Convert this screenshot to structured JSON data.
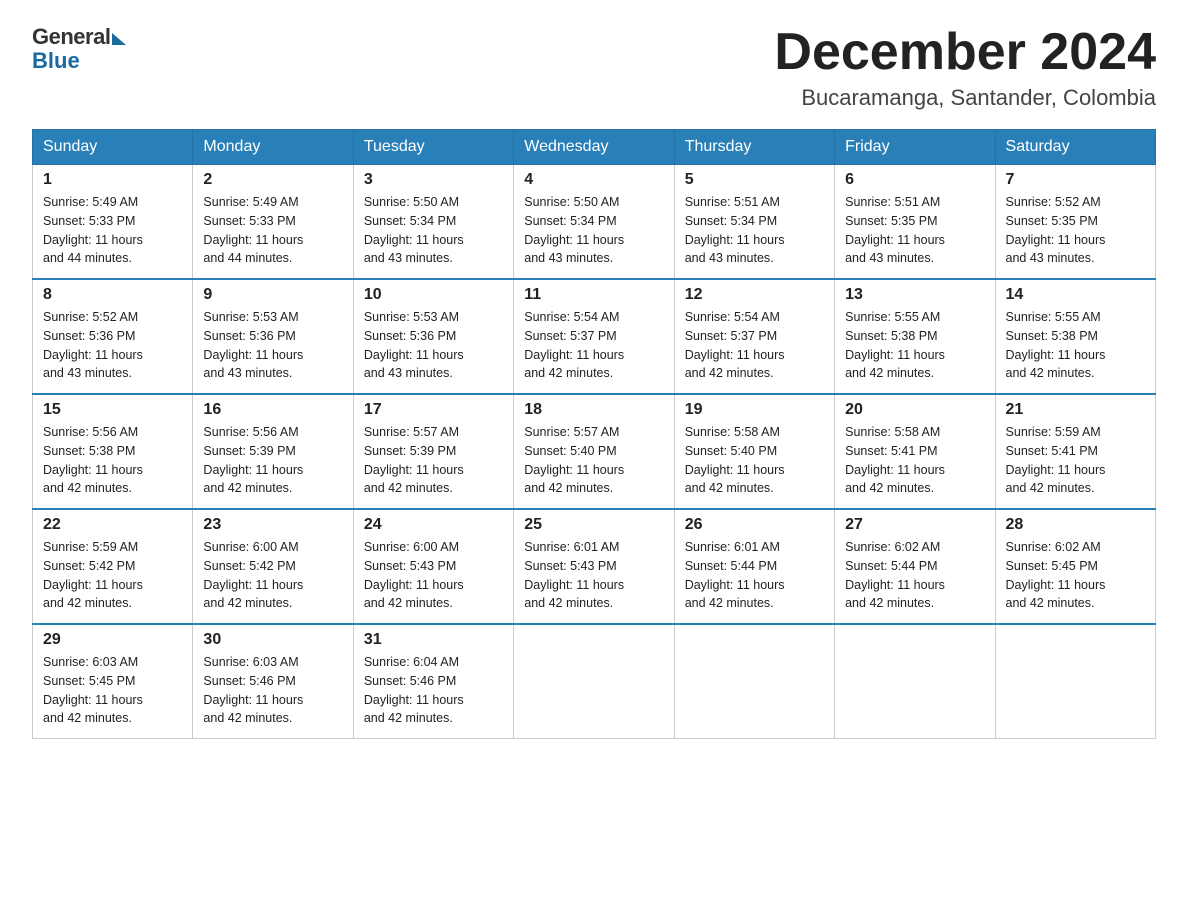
{
  "logo": {
    "general": "General",
    "blue": "Blue"
  },
  "header": {
    "month": "December 2024",
    "location": "Bucaramanga, Santander, Colombia"
  },
  "days_of_week": [
    "Sunday",
    "Monday",
    "Tuesday",
    "Wednesday",
    "Thursday",
    "Friday",
    "Saturday"
  ],
  "weeks": [
    [
      {
        "day": "1",
        "sunrise": "5:49 AM",
        "sunset": "5:33 PM",
        "daylight": "11 hours and 44 minutes."
      },
      {
        "day": "2",
        "sunrise": "5:49 AM",
        "sunset": "5:33 PM",
        "daylight": "11 hours and 44 minutes."
      },
      {
        "day": "3",
        "sunrise": "5:50 AM",
        "sunset": "5:34 PM",
        "daylight": "11 hours and 43 minutes."
      },
      {
        "day": "4",
        "sunrise": "5:50 AM",
        "sunset": "5:34 PM",
        "daylight": "11 hours and 43 minutes."
      },
      {
        "day": "5",
        "sunrise": "5:51 AM",
        "sunset": "5:34 PM",
        "daylight": "11 hours and 43 minutes."
      },
      {
        "day": "6",
        "sunrise": "5:51 AM",
        "sunset": "5:35 PM",
        "daylight": "11 hours and 43 minutes."
      },
      {
        "day": "7",
        "sunrise": "5:52 AM",
        "sunset": "5:35 PM",
        "daylight": "11 hours and 43 minutes."
      }
    ],
    [
      {
        "day": "8",
        "sunrise": "5:52 AM",
        "sunset": "5:36 PM",
        "daylight": "11 hours and 43 minutes."
      },
      {
        "day": "9",
        "sunrise": "5:53 AM",
        "sunset": "5:36 PM",
        "daylight": "11 hours and 43 minutes."
      },
      {
        "day": "10",
        "sunrise": "5:53 AM",
        "sunset": "5:36 PM",
        "daylight": "11 hours and 43 minutes."
      },
      {
        "day": "11",
        "sunrise": "5:54 AM",
        "sunset": "5:37 PM",
        "daylight": "11 hours and 42 minutes."
      },
      {
        "day": "12",
        "sunrise": "5:54 AM",
        "sunset": "5:37 PM",
        "daylight": "11 hours and 42 minutes."
      },
      {
        "day": "13",
        "sunrise": "5:55 AM",
        "sunset": "5:38 PM",
        "daylight": "11 hours and 42 minutes."
      },
      {
        "day": "14",
        "sunrise": "5:55 AM",
        "sunset": "5:38 PM",
        "daylight": "11 hours and 42 minutes."
      }
    ],
    [
      {
        "day": "15",
        "sunrise": "5:56 AM",
        "sunset": "5:38 PM",
        "daylight": "11 hours and 42 minutes."
      },
      {
        "day": "16",
        "sunrise": "5:56 AM",
        "sunset": "5:39 PM",
        "daylight": "11 hours and 42 minutes."
      },
      {
        "day": "17",
        "sunrise": "5:57 AM",
        "sunset": "5:39 PM",
        "daylight": "11 hours and 42 minutes."
      },
      {
        "day": "18",
        "sunrise": "5:57 AM",
        "sunset": "5:40 PM",
        "daylight": "11 hours and 42 minutes."
      },
      {
        "day": "19",
        "sunrise": "5:58 AM",
        "sunset": "5:40 PM",
        "daylight": "11 hours and 42 minutes."
      },
      {
        "day": "20",
        "sunrise": "5:58 AM",
        "sunset": "5:41 PM",
        "daylight": "11 hours and 42 minutes."
      },
      {
        "day": "21",
        "sunrise": "5:59 AM",
        "sunset": "5:41 PM",
        "daylight": "11 hours and 42 minutes."
      }
    ],
    [
      {
        "day": "22",
        "sunrise": "5:59 AM",
        "sunset": "5:42 PM",
        "daylight": "11 hours and 42 minutes."
      },
      {
        "day": "23",
        "sunrise": "6:00 AM",
        "sunset": "5:42 PM",
        "daylight": "11 hours and 42 minutes."
      },
      {
        "day": "24",
        "sunrise": "6:00 AM",
        "sunset": "5:43 PM",
        "daylight": "11 hours and 42 minutes."
      },
      {
        "day": "25",
        "sunrise": "6:01 AM",
        "sunset": "5:43 PM",
        "daylight": "11 hours and 42 minutes."
      },
      {
        "day": "26",
        "sunrise": "6:01 AM",
        "sunset": "5:44 PM",
        "daylight": "11 hours and 42 minutes."
      },
      {
        "day": "27",
        "sunrise": "6:02 AM",
        "sunset": "5:44 PM",
        "daylight": "11 hours and 42 minutes."
      },
      {
        "day": "28",
        "sunrise": "6:02 AM",
        "sunset": "5:45 PM",
        "daylight": "11 hours and 42 minutes."
      }
    ],
    [
      {
        "day": "29",
        "sunrise": "6:03 AM",
        "sunset": "5:45 PM",
        "daylight": "11 hours and 42 minutes."
      },
      {
        "day": "30",
        "sunrise": "6:03 AM",
        "sunset": "5:46 PM",
        "daylight": "11 hours and 42 minutes."
      },
      {
        "day": "31",
        "sunrise": "6:04 AM",
        "sunset": "5:46 PM",
        "daylight": "11 hours and 42 minutes."
      },
      null,
      null,
      null,
      null
    ]
  ],
  "labels": {
    "sunrise": "Sunrise:",
    "sunset": "Sunset:",
    "daylight": "Daylight:"
  }
}
